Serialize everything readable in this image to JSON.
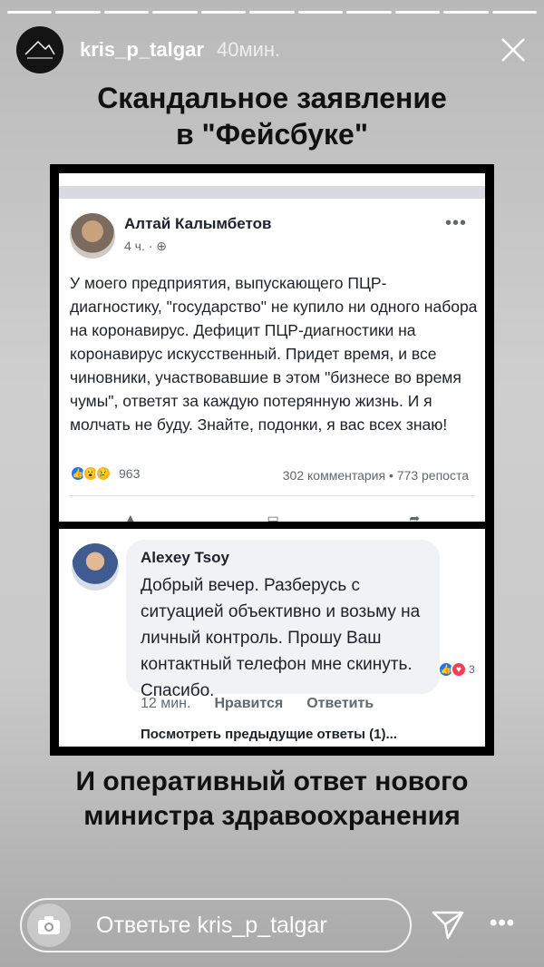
{
  "story": {
    "username": "kris_p_talgar",
    "time": "40мин.",
    "segments": 11
  },
  "headline_top": [
    "Скандальное заявление",
    "в \"Фейсбуке\""
  ],
  "headline_bottom": [
    "И оперативный ответ нового",
    "министра здравоохранения"
  ],
  "post": {
    "author": "Алтай Калымбетов",
    "meta": "4 ч. · ⊕",
    "more": "•••",
    "text": "У моего предприятия, выпускающего ПЦР-диагностику, \"государство\" не купило ни одного набора на коронавирус. Дефицит ПЦР-диагностики на коронавирус искусственный. Придет время, и все чиновники, участвовавшие в этом \"бизнесе во время чумы\", ответят за каждую потерянную жизнь. И я молчать не буду. Знайте, подонки, я вас всех знаю!",
    "reaction_count": "963",
    "stats": "302 комментария • 773 репоста"
  },
  "comment": {
    "name": "Alexey Tsoy",
    "text": "Добрый вечер. Разберусь с ситуацией объективно и возьму на личный контроль. Прошу Ваш контактный телефон мне скинуть. Спасибо.",
    "reaction_count": "3",
    "time": "12 мин.",
    "like": "Нравится",
    "reply": "Ответить",
    "more_replies": "Посмотреть предыдущие ответы (1)..."
  },
  "reply_bar": {
    "placeholder": "Ответьте kris_p_talgar"
  },
  "colors": {
    "like_blue": "#1877f2",
    "wow_yellow": "#f7b928",
    "love_red": "#f33e58"
  }
}
